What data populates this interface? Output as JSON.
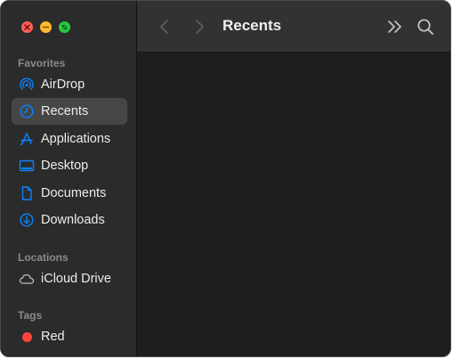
{
  "window": {
    "title": "Recents"
  },
  "sidebar": {
    "sections": {
      "favorites": "Favorites",
      "locations": "Locations",
      "tags": "Tags"
    },
    "favorites": [
      {
        "label": "AirDrop",
        "icon": "airdrop-icon"
      },
      {
        "label": "Recents",
        "icon": "clock-icon",
        "selected": true
      },
      {
        "label": "Applications",
        "icon": "applications-icon"
      },
      {
        "label": "Desktop",
        "icon": "desktop-icon"
      },
      {
        "label": "Documents",
        "icon": "document-icon"
      },
      {
        "label": "Downloads",
        "icon": "download-icon"
      }
    ],
    "locations": [
      {
        "label": "iCloud Drive",
        "icon": "cloud-icon"
      }
    ],
    "tags": [
      {
        "label": "Red",
        "color": "#ff453a"
      }
    ]
  },
  "toolbar": {
    "back_icon": "chevron-left-icon",
    "forward_icon": "chevron-right-icon",
    "more_icon": "double-chevron-right-icon",
    "search_icon": "search-icon"
  },
  "colors": {
    "accent": "#0a84ff",
    "sidebar_bg": "#2b2b2b",
    "content_bg": "#1e1e1e",
    "selection_bg": "#464646",
    "close": "#ff5f57",
    "minimize": "#febc2e",
    "zoom": "#28c840"
  }
}
